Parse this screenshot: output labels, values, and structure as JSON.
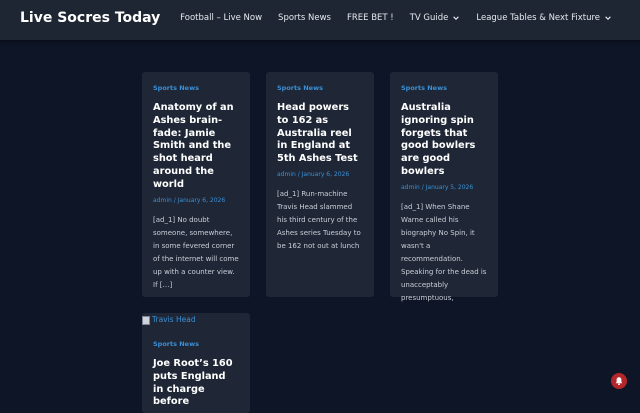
{
  "site_title": "Live Socres Today",
  "nav": {
    "items": [
      {
        "label": "Football – Live Now",
        "dropdown": false
      },
      {
        "label": "Sports News",
        "dropdown": false
      },
      {
        "label": "FREE BET !",
        "dropdown": false
      },
      {
        "label": "TV Guide",
        "dropdown": true
      },
      {
        "label": "League Tables & Next Fixture",
        "dropdown": true
      }
    ]
  },
  "posts": [
    {
      "category": "Sports News",
      "title": "Anatomy of an Ashes brain-fade: Jamie Smith and the shot heard around the world",
      "meta": "admin / January 6, 2026",
      "excerpt": "[ad_1] No doubt someone, somewhere, in some fevered corner of the internet will come up with a counter view. If […]"
    },
    {
      "category": "Sports News",
      "title": "Head powers to 162 as Australia reel in England at 5th Ashes Test",
      "meta": "admin / January 6, 2026",
      "excerpt": "[ad_1] Run-machine Travis Head slammed his third century of the Ashes series Tuesday to be 162 not out at lunch"
    },
    {
      "category": "Sports News",
      "title": "Australia ignoring spin forgets that good bowlers are good bowlers",
      "meta": "admin / January 5, 2026",
      "excerpt": "[ad_1] When Shane Warne called his biography No Spin, it wasn't a recommendation. Speaking for the dead is unacceptably presumptuous,"
    },
    {
      "image_alt": "Travis Head",
      "category": "Sports News",
      "title": "Joe Root’s 160 puts England in charge before"
    }
  ],
  "colors": {
    "page_bg": "#0e1526",
    "header_bg": "#1e2633",
    "card_bg": "#1f2736",
    "accent": "#3a8fd6",
    "fab": "#b3262a"
  },
  "icons": {
    "dropdown": "chevron-down-icon",
    "fab": "bell-icon"
  }
}
